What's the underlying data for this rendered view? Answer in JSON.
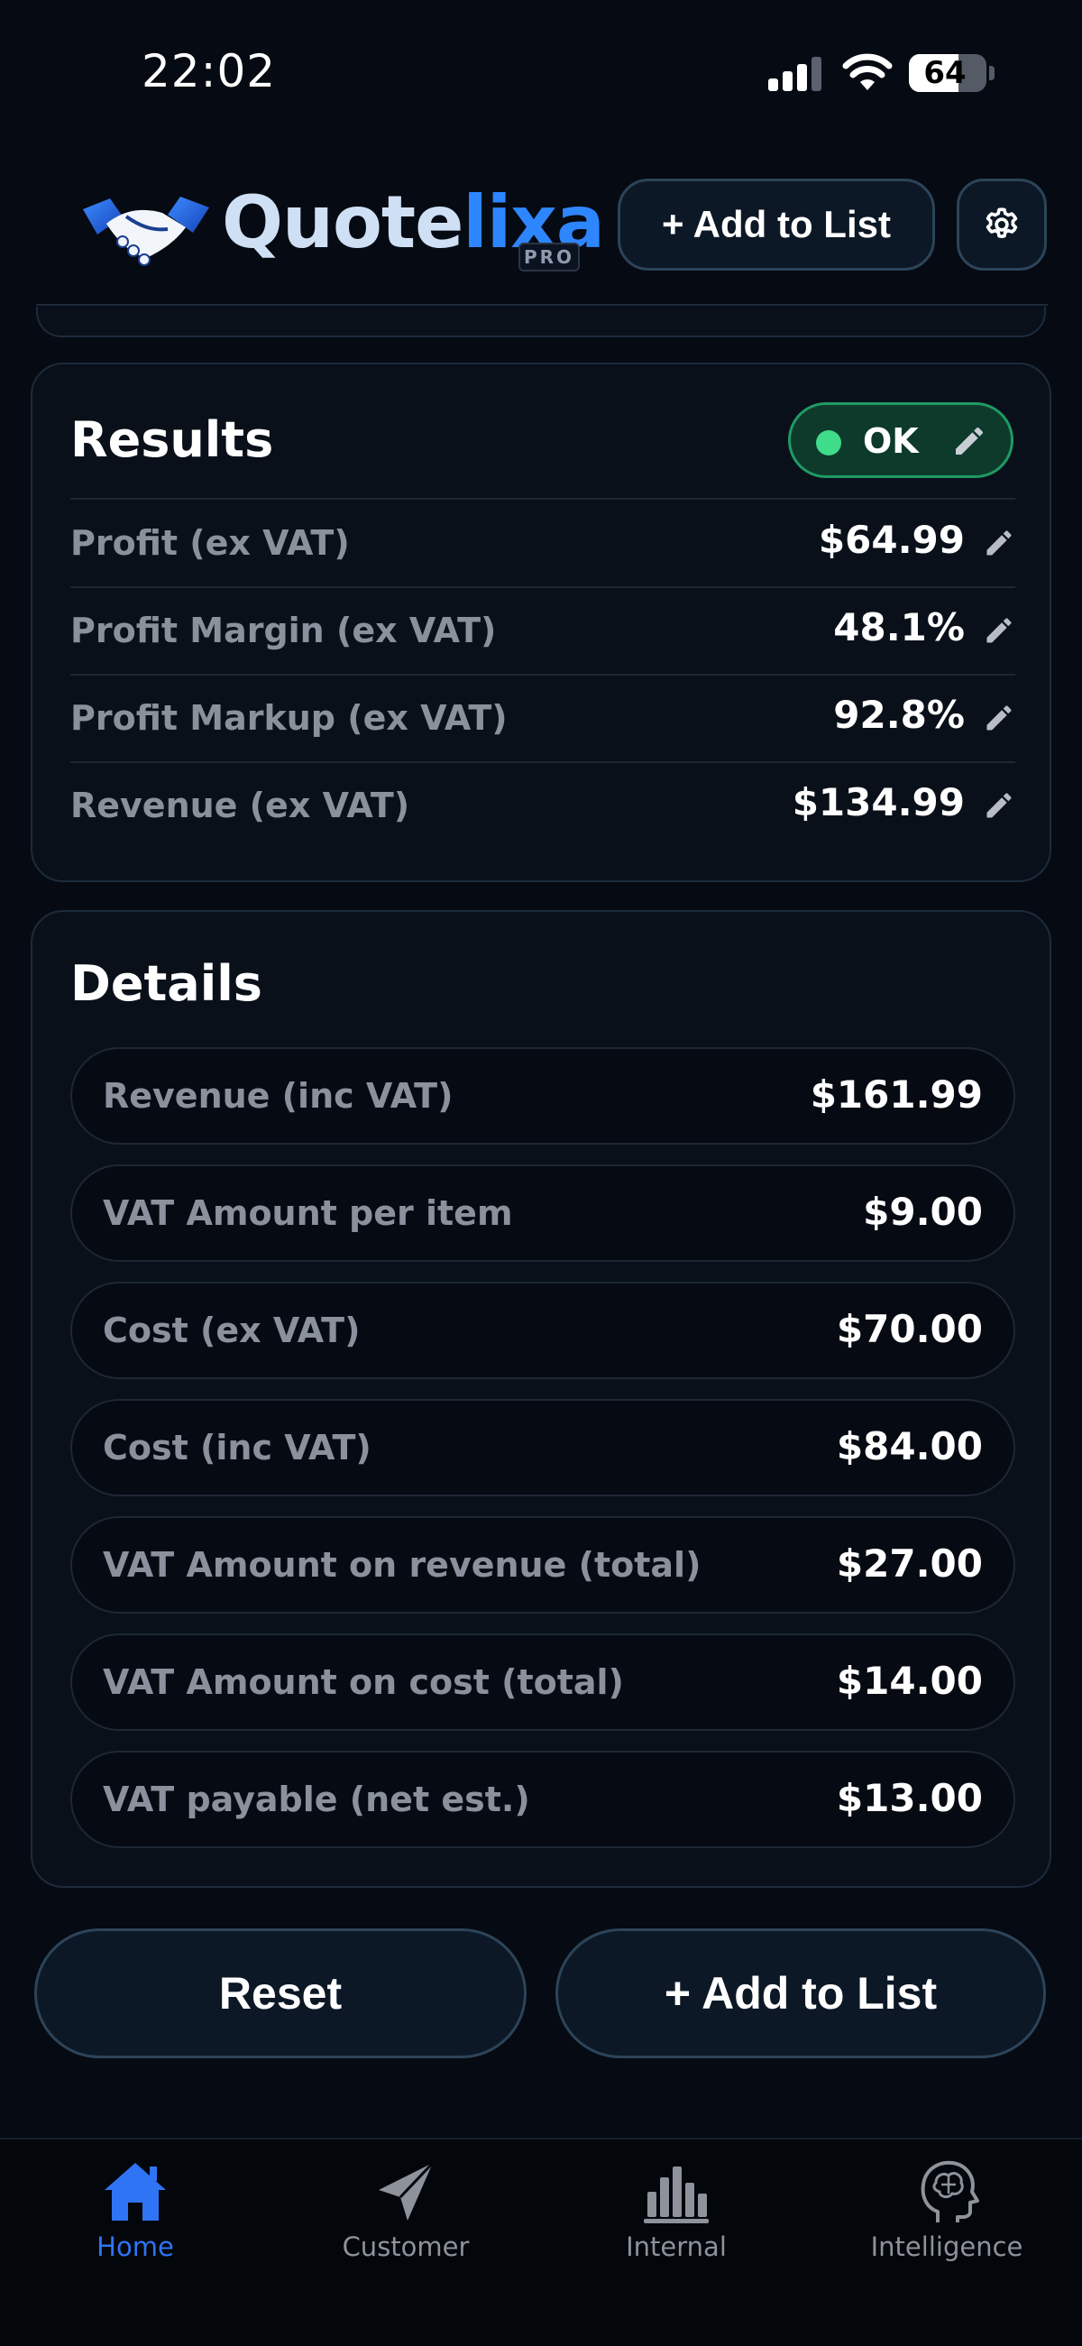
{
  "status_bar": {
    "time": "22:02",
    "battery": "64",
    "battery_level": 0.64
  },
  "header": {
    "logo_text_part1": "Quote",
    "logo_text_part2": "lixa",
    "logo_badge": "PRO",
    "add_to_list_label": "+ Add to List",
    "settings_icon": "gear-icon"
  },
  "results": {
    "title": "Results",
    "status_label": "OK",
    "status_color": "#3fdc8c",
    "rows": [
      {
        "label": "Profit (ex VAT)",
        "value": "$64.99"
      },
      {
        "label": "Profit Margin (ex VAT)",
        "value": "48.1%"
      },
      {
        "label": "Profit Markup (ex VAT)",
        "value": "92.8%"
      },
      {
        "label": "Revenue (ex VAT)",
        "value": "$134.99"
      }
    ]
  },
  "details": {
    "title": "Details",
    "rows": [
      {
        "label": "Revenue (inc VAT)",
        "value": "$161.99"
      },
      {
        "label": "VAT Amount per item",
        "value": "$9.00"
      },
      {
        "label": "Cost (ex VAT)",
        "value": "$70.00"
      },
      {
        "label": "Cost (inc VAT)",
        "value": "$84.00"
      },
      {
        "label": "VAT Amount on revenue (total)",
        "value": "$27.00"
      },
      {
        "label": "VAT Amount on cost (total)",
        "value": "$14.00"
      },
      {
        "label": "VAT payable (net est.)",
        "value": "$13.00"
      }
    ]
  },
  "actions": {
    "reset_label": "Reset",
    "add_to_list_label": "+ Add to List"
  },
  "tab_bar": {
    "active_color": "#2f74f5",
    "tabs": [
      {
        "label": "Home",
        "icon": "home-icon",
        "active": true
      },
      {
        "label": "Customer",
        "icon": "paper-plane-icon",
        "active": false
      },
      {
        "label": "Internal",
        "icon": "bar-chart-icon",
        "active": false
      },
      {
        "label": "Intelligence",
        "icon": "brain-head-icon",
        "active": false
      }
    ]
  }
}
